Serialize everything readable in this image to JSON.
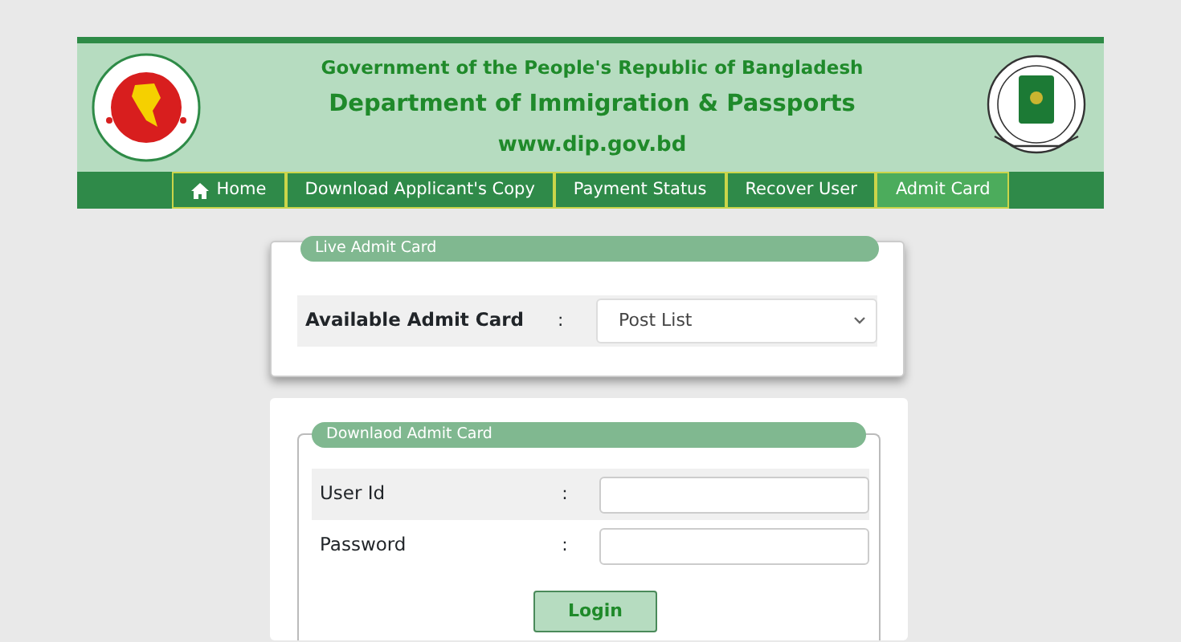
{
  "header": {
    "subtitle": "Government of the People's Republic of Bangladesh",
    "title": "Department of Immigration & Passports",
    "website": "www.dip.gov.bd"
  },
  "nav": [
    {
      "label": "Home",
      "kind": "home",
      "selected": false
    },
    {
      "label": "Download Applicant's Copy",
      "kind": "link",
      "selected": false
    },
    {
      "label": "Payment Status",
      "kind": "link",
      "selected": false
    },
    {
      "label": "Recover User",
      "kind": "link",
      "selected": false
    },
    {
      "label": "Admit Card",
      "kind": "link",
      "selected": true
    }
  ],
  "live_card": {
    "legend": "Live Admit Card",
    "label": "Available Admit Card",
    "separator": ":",
    "select_value": "Post List"
  },
  "download_card": {
    "legend": "Downlaod Admit Card",
    "fields": [
      {
        "label": "User Id",
        "separator": ":"
      },
      {
        "label": "Password",
        "separator": ":"
      }
    ],
    "button": "Login"
  }
}
